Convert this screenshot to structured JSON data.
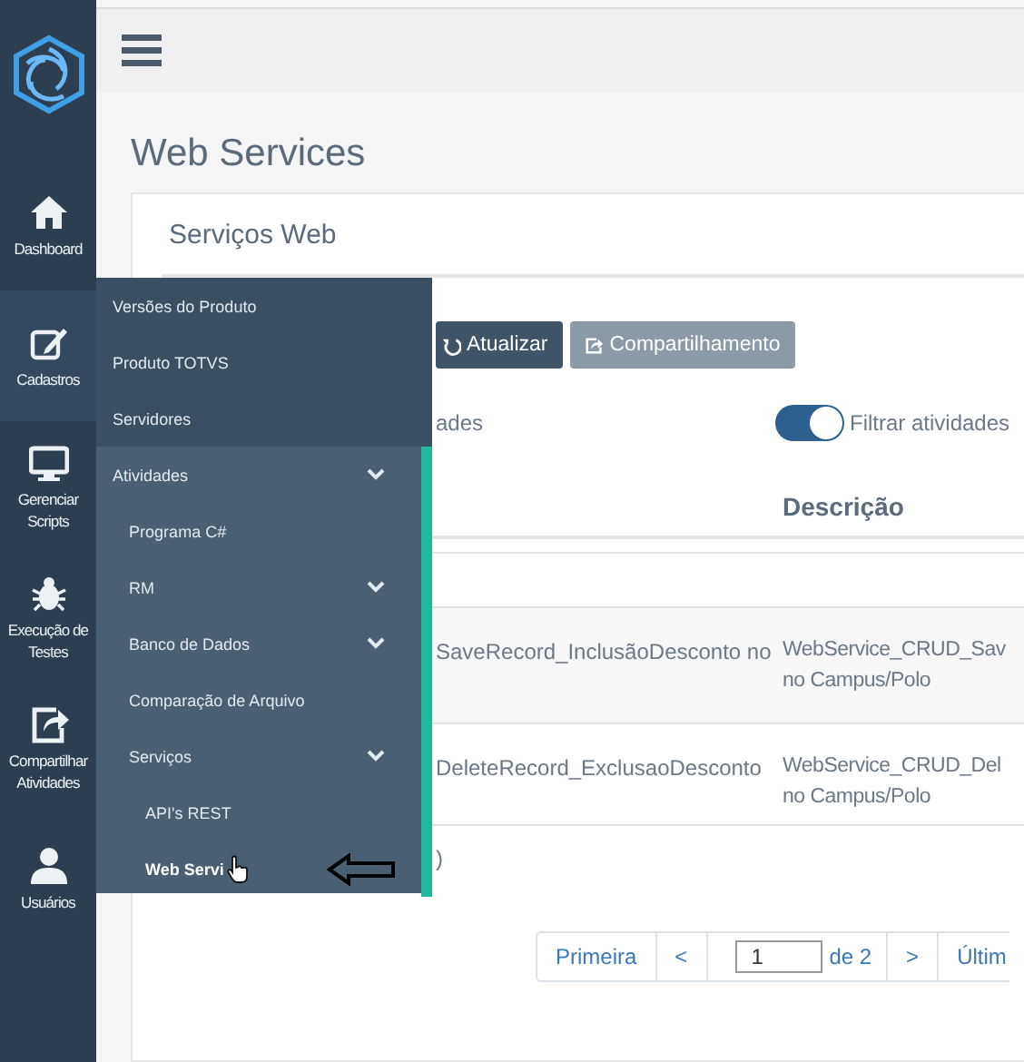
{
  "sidebar": {
    "items": [
      {
        "label": "Dashboard",
        "selected": false
      },
      {
        "label": "Cadastros",
        "selected": true
      },
      {
        "label": "Gerenciar Scripts",
        "selected": false
      },
      {
        "label": "Execução de Testes",
        "selected": false
      },
      {
        "label": "Compartilhar Atividades",
        "selected": false
      },
      {
        "label": "Usuários",
        "selected": false
      }
    ]
  },
  "page_title": "Web Services",
  "card": {
    "title": "Serviços Web",
    "buttons": [
      {
        "label": "Atualizar",
        "kind": "primary"
      },
      {
        "label": "Compartilhamento",
        "kind": "secondary"
      }
    ],
    "left_label": "ades",
    "toggle": {
      "label": "Filtrar atividades",
      "on": true
    },
    "table": {
      "columns": [
        "Descrição"
      ],
      "rows": [
        {
          "column_1": "SaveRecord_InclusãoDesconto no",
          "descricao": [
            "WebService_CRUD_Sav",
            "no Campus/Polo"
          ]
        },
        {
          "column_1": "DeleteRecord_ExclusaoDesconto",
          "descricao": [
            "WebService_CRUD_Del",
            "no Campus/Polo"
          ]
        }
      ],
      "footer": ")"
    },
    "pagination": {
      "first": "Primeira",
      "prev": "<",
      "page": "1",
      "of": "de 2",
      "next": ">",
      "last": "Últim"
    }
  },
  "flyout": {
    "items": [
      {
        "label": "Versões do Produto",
        "kind": "link",
        "selected": false
      },
      {
        "label": "Produto TOTVS",
        "kind": "link",
        "selected": false
      },
      {
        "label": "Servidores",
        "kind": "link",
        "selected": false
      },
      {
        "label": "Atividades",
        "kind": "group",
        "selected": false,
        "children": [
          {
            "label": "Programa C#",
            "kind": "link",
            "selected": false
          },
          {
            "label": "RM",
            "kind": "group",
            "selected": false
          },
          {
            "label": "Banco de Dados",
            "kind": "group",
            "selected": false
          },
          {
            "label": "Comparação de Arquivo",
            "kind": "link",
            "selected": false
          },
          {
            "label": "Serviços",
            "kind": "group",
            "selected": false,
            "children": [
              {
                "label": "API's REST",
                "kind": "link",
                "selected": false
              },
              {
                "label": "Web Servi",
                "kind": "link",
                "selected": true
              }
            ]
          }
        ]
      }
    ]
  }
}
